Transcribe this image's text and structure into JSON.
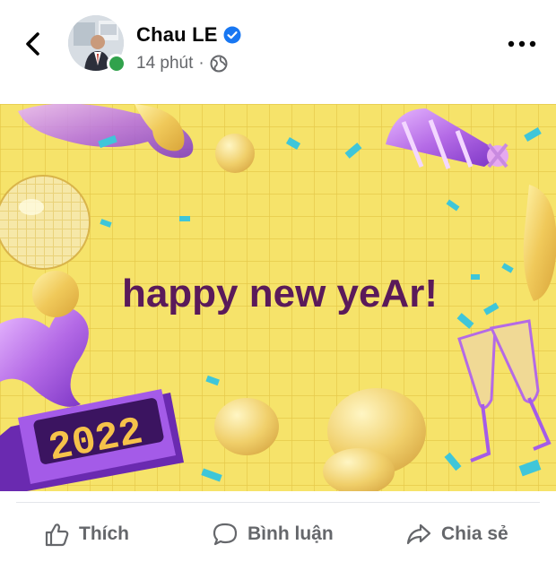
{
  "post": {
    "author": "Chau LE",
    "time": "14 phút",
    "separator": "·",
    "image_text": "happy new yeAr!",
    "image_year": "2022"
  },
  "actions": {
    "like": "Thích",
    "comment": "Bình luận",
    "share": "Chia sẻ"
  },
  "colors": {
    "verified": "#1877f2",
    "online": "#31a24c",
    "background_yellow": "#f6e36a",
    "headline": "#5a1a5a",
    "purple": "#8a3fd1"
  },
  "icons": [
    "back-icon",
    "verified-badge-icon",
    "globe-icon",
    "more-icon",
    "like-icon",
    "comment-icon",
    "share-icon"
  ]
}
